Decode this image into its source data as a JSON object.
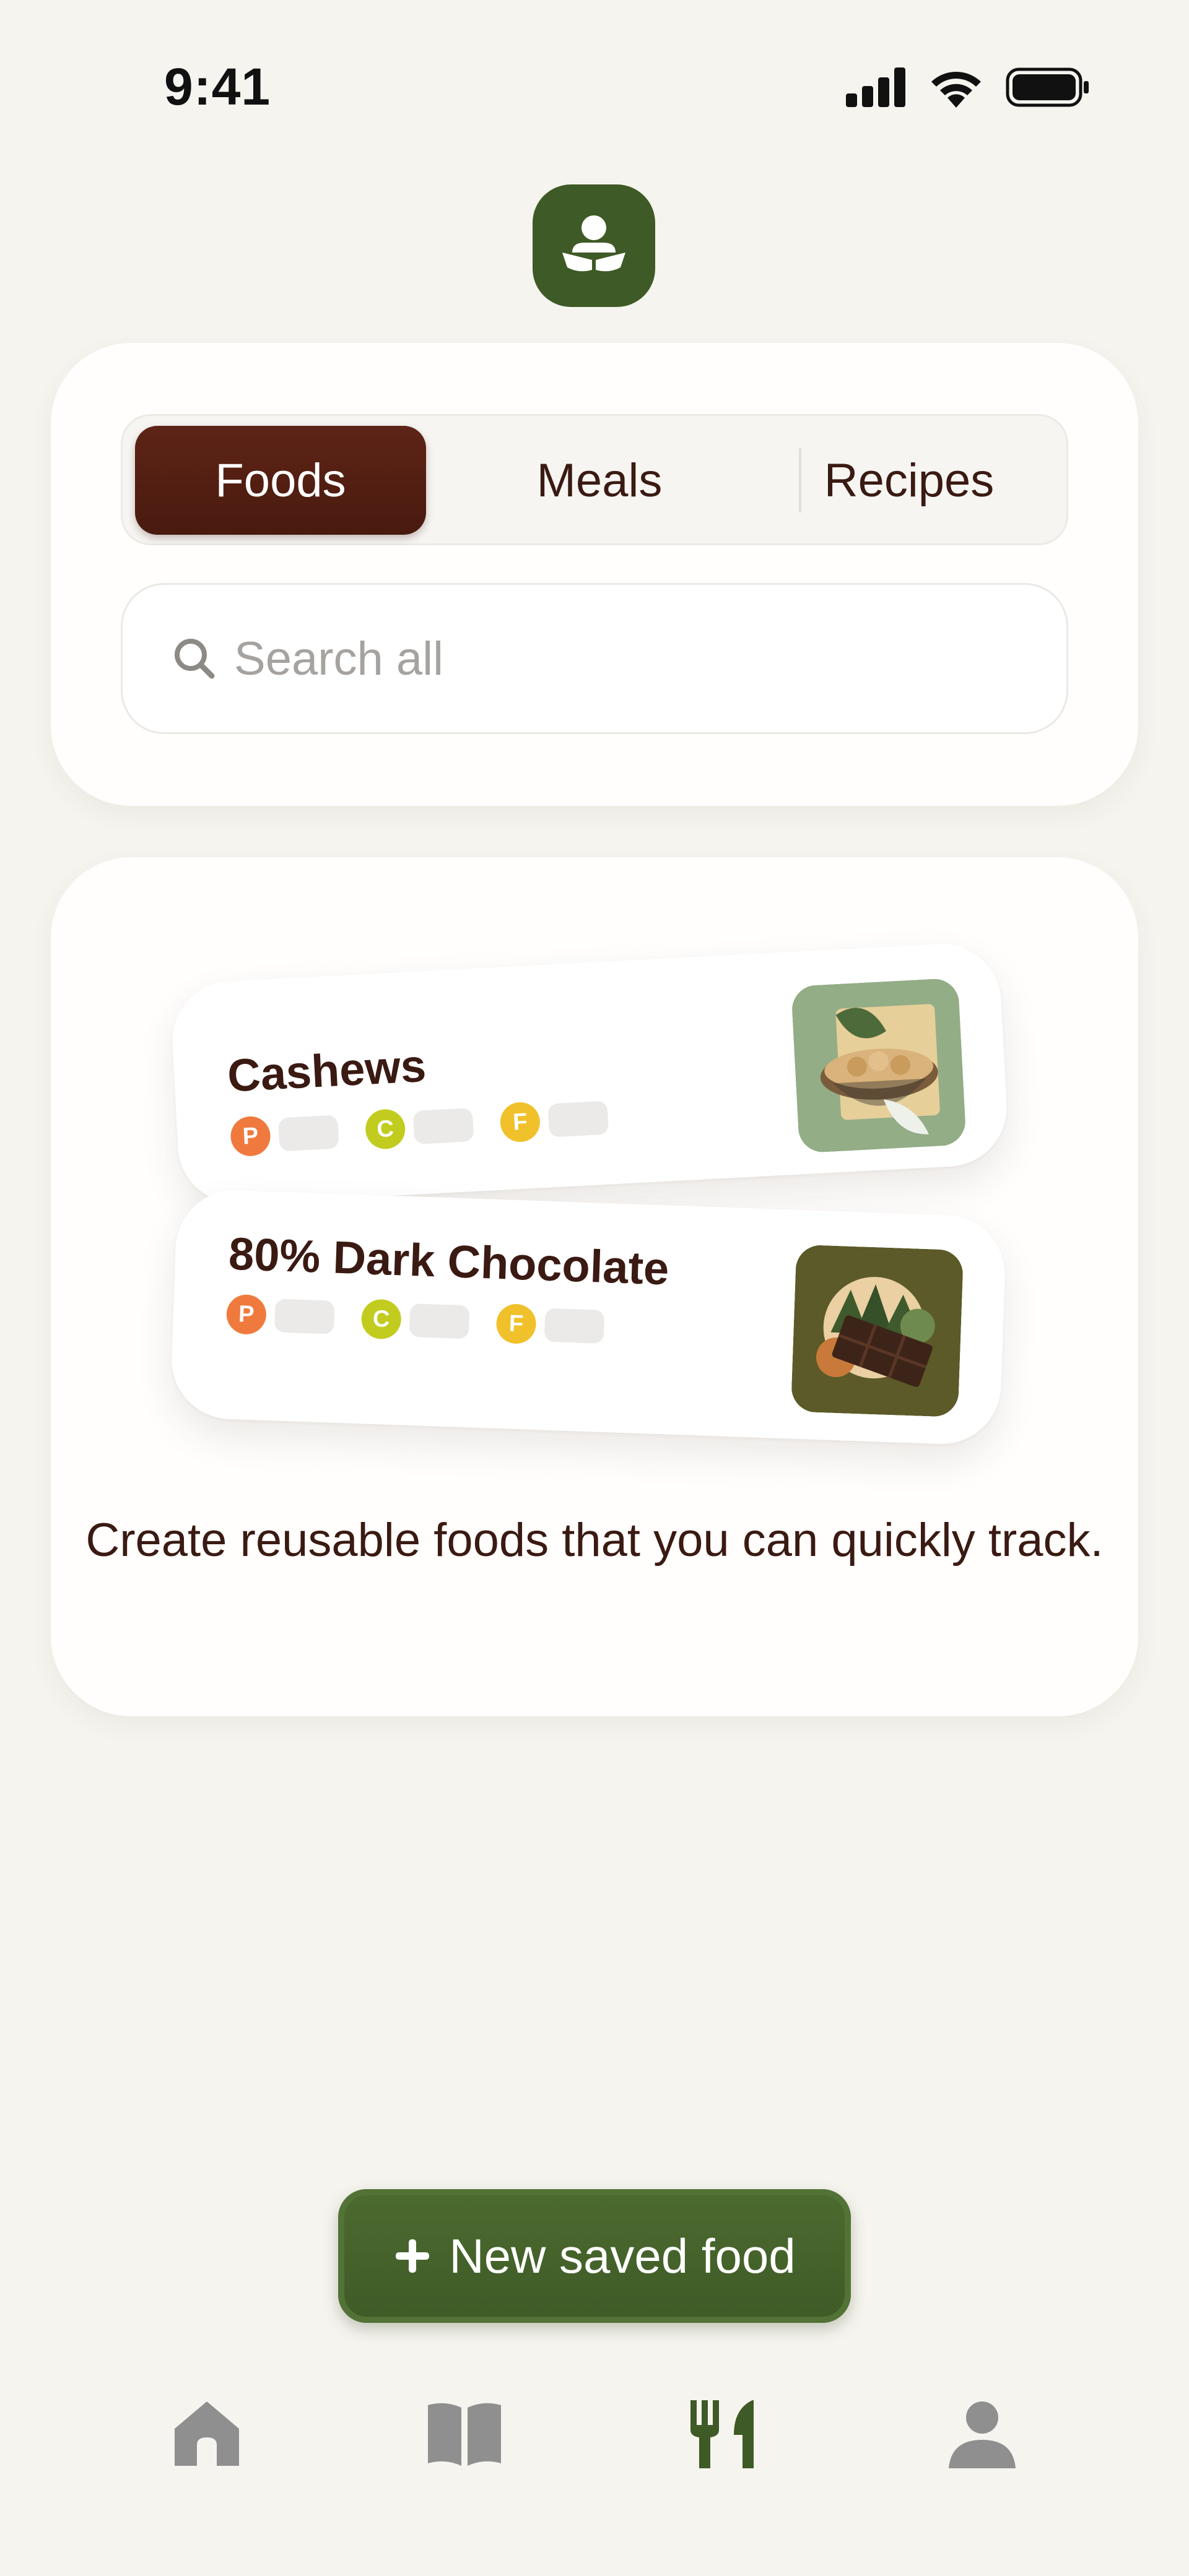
{
  "status_bar": {
    "time": "9:41"
  },
  "tabs": {
    "foods": "Foods",
    "meals": "Meals",
    "recipes": "Recipes"
  },
  "search": {
    "placeholder": "Search all"
  },
  "examples": [
    {
      "name": "Cashews",
      "thumb_icon": "cashew-bowl-image"
    },
    {
      "name": "80% Dark Chocolate",
      "thumb_icon": "dark-chocolate-image"
    }
  ],
  "macros": {
    "protein": "P",
    "carbs": "C",
    "fat": "F"
  },
  "empty_state": {
    "caption": "Create reusable foods that you can quickly track."
  },
  "new_button": {
    "label": "New saved food"
  },
  "tab_bar": [
    "home-icon",
    "book-icon",
    "fork-knife-icon",
    "profile-icon"
  ],
  "colors": {
    "background": "#f6f4ef",
    "brand_green": "#3e5a26",
    "brown_selected": "#5d2416",
    "text": "#3a1a12",
    "protein": "#f07a3e",
    "carbs": "#c2cc1f",
    "fat": "#f0c12a",
    "inactive_icon": "#8f8f8f"
  }
}
